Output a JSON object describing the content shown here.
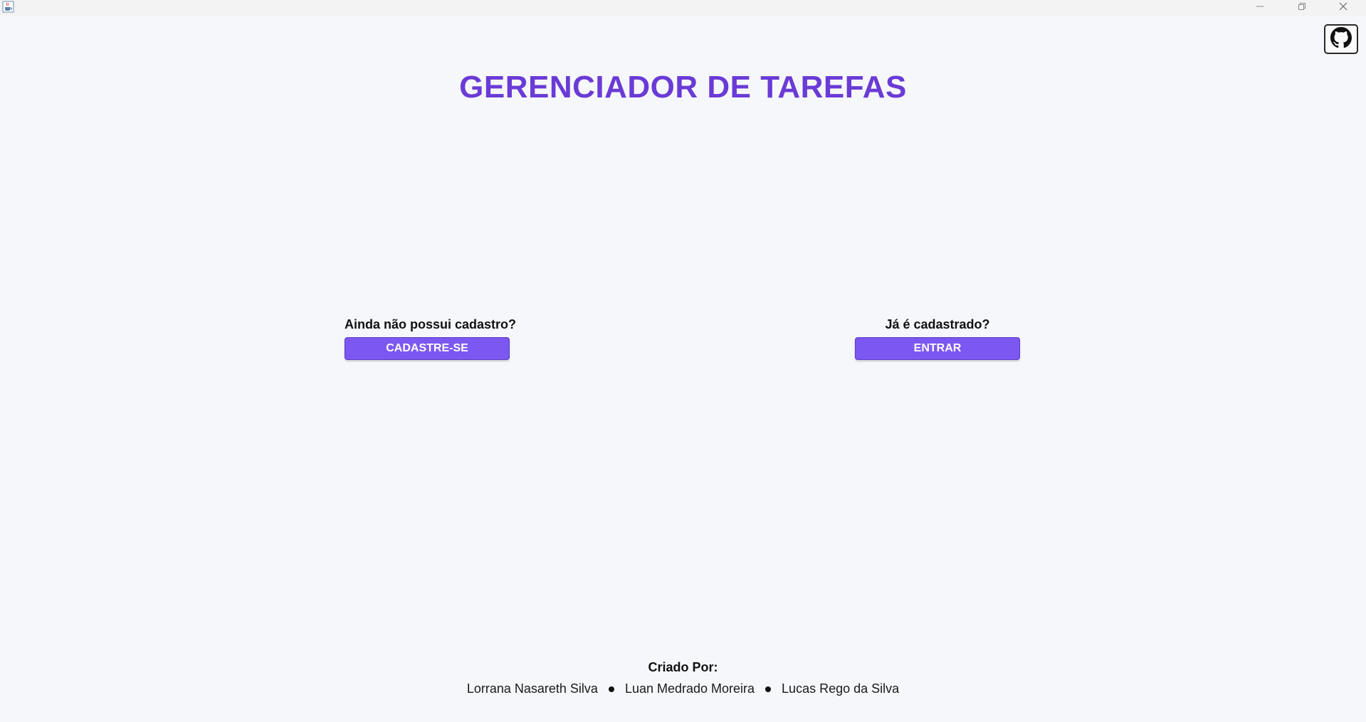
{
  "window": {
    "app_icon": "java-cup-icon",
    "controls": [
      "minimize-icon",
      "maximize-icon",
      "close-icon"
    ]
  },
  "header": {
    "title": "GERENCIADOR DE TAREFAS",
    "title_color": "#6a3bd6",
    "github_icon": "github-icon"
  },
  "register": {
    "question": "Ainda não possui cadastro?",
    "button_label": "CADASTRE-SE"
  },
  "login": {
    "question": "Já é cadastrado?",
    "button_label": "ENTRAR"
  },
  "accent_color": "#7d57f2",
  "credits": {
    "label": "Criado Por:",
    "authors": [
      "Lorrana Nasareth Silva",
      "Luan Medrado Moreira",
      "Lucas Rego da Silva"
    ]
  }
}
